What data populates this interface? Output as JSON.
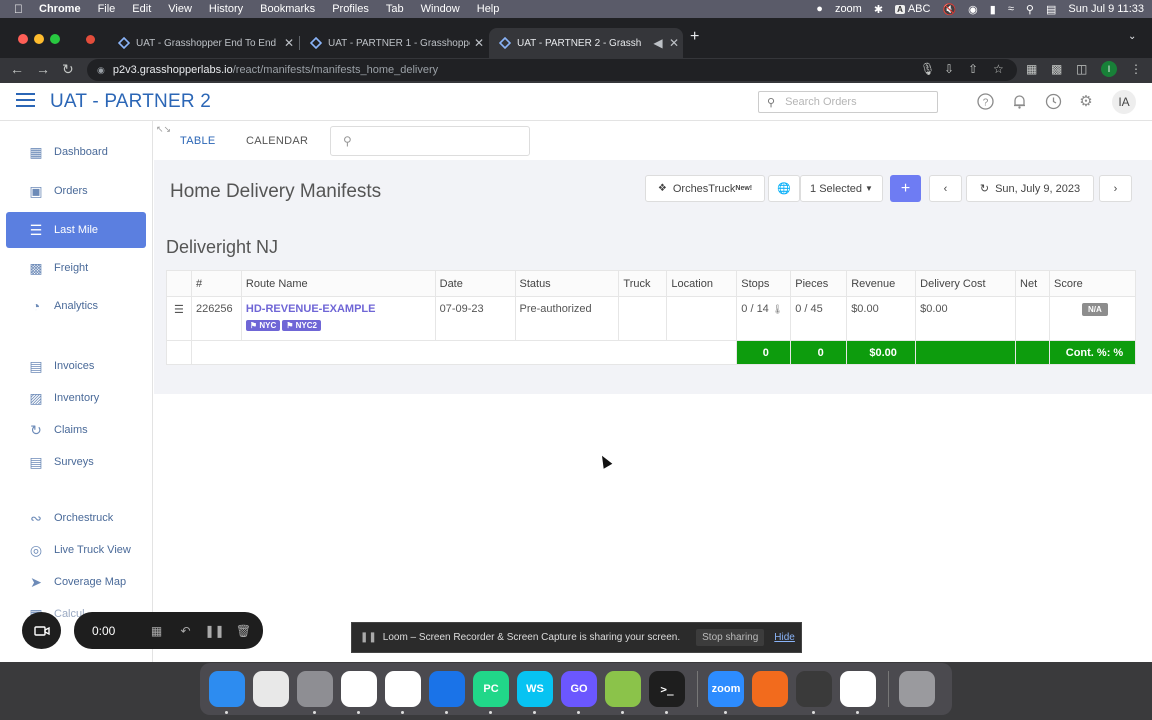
{
  "menubar": {
    "app": "Chrome",
    "items": [
      "File",
      "Edit",
      "View",
      "History",
      "Bookmarks",
      "Profiles",
      "Tab",
      "Window",
      "Help"
    ],
    "zoom": "zoom",
    "input_source": "ABC",
    "datetime": "Sun Jul 9  11:33"
  },
  "browser": {
    "tabs": [
      {
        "title": "UAT - Grasshopper End To End"
      },
      {
        "title": "UAT - PARTNER 1 - Grasshopper"
      },
      {
        "title": "UAT - PARTNER 2 - Grassh"
      }
    ],
    "new_tab": "+",
    "url_host": "p2v3.grasshopperlabs.io",
    "url_path": "/react/manifests/manifests_home_delivery",
    "profile_initial": "I"
  },
  "app": {
    "brand": "UAT - PARTNER 2",
    "search_placeholder": "Search Orders",
    "avatar": "IA"
  },
  "sidebar": {
    "items": [
      {
        "label": "Dashboard",
        "icon": "dashboard-icon"
      },
      {
        "label": "Orders",
        "icon": "box-icon"
      },
      {
        "label": "Last Mile",
        "icon": "last-mile-icon"
      },
      {
        "label": "Freight",
        "icon": "truck-icon"
      },
      {
        "label": "Analytics",
        "icon": "analytics-icon"
      },
      {
        "label": "Invoices",
        "icon": "invoice-icon"
      },
      {
        "label": "Inventory",
        "icon": "inventory-icon"
      },
      {
        "label": "Claims",
        "icon": "claims-icon"
      },
      {
        "label": "Surveys",
        "icon": "survey-icon"
      },
      {
        "label": "Orchestruck",
        "icon": "orchestruck-icon"
      },
      {
        "label": "Live Truck View",
        "icon": "target-icon"
      },
      {
        "label": "Coverage Map",
        "icon": "navigation-icon"
      },
      {
        "label": "Calcul",
        "icon": "calculator-icon"
      }
    ],
    "active": "Last Mile"
  },
  "main": {
    "tabs": [
      "TABLE",
      "CALENDAR"
    ],
    "active_tab": "TABLE",
    "page_title": "Home Delivery Manifests",
    "orchestruck_label": "OrchesTruck",
    "orchestruck_badge": "New!",
    "selected_label": "1 Selected",
    "add_label": "+",
    "date_label": "Sun, July 9, 2023",
    "group_title": "Deliveright NJ",
    "table": {
      "columns": [
        "",
        "#",
        "Route Name",
        "Date",
        "Status",
        "Truck",
        "Location",
        "Stops",
        "Pieces",
        "Revenue",
        "Delivery Cost",
        "Net",
        "Score"
      ],
      "row": {
        "id": "226256",
        "route_name": "HD-REVENUE-EXAMPLE",
        "tags": [
          "NYC",
          "NYC2"
        ],
        "date": "07-09-23",
        "status": "Pre-authorized",
        "truck": "",
        "location": "",
        "stops": "0 / 14",
        "pieces": "0 / 45",
        "revenue": "$0.00",
        "delivery_cost": "$0.00",
        "net": "",
        "score": "N/A"
      },
      "totals": {
        "stops": "0",
        "pieces": "0",
        "revenue": "$0.00",
        "score": "Cont. %: %"
      }
    }
  },
  "loom": {
    "timer": "0:00",
    "message": "Loom – Screen Recorder & Screen Capture is sharing your screen.",
    "stop_label": "Stop sharing",
    "hide_label": "Hide"
  },
  "dock": {
    "apps": [
      {
        "name": "Finder",
        "icon": "finder-icon",
        "color": "#2d8cf0",
        "running": true
      },
      {
        "name": "Launchpad",
        "icon": "launchpad-icon",
        "color": "#e8e8e8",
        "running": false
      },
      {
        "name": "System Settings",
        "icon": "settings-icon",
        "color": "#8e8e93",
        "running": true
      },
      {
        "name": "Chrome",
        "icon": "chrome-icon",
        "color": "#ffffff",
        "running": true
      },
      {
        "name": "Slack",
        "icon": "slack-icon",
        "color": "#ffffff",
        "running": true
      },
      {
        "name": "Maps",
        "icon": "maps-icon",
        "color": "#1a73e8",
        "running": true
      },
      {
        "name": "PyCharm",
        "icon": "pycharm-icon",
        "color": "#21d789",
        "label": "PC",
        "running": true
      },
      {
        "name": "WebStorm",
        "icon": "webstorm-icon",
        "color": "#07c3f2",
        "label": "WS",
        "running": true
      },
      {
        "name": "GoLand",
        "icon": "goland-icon",
        "color": "#6b57ff",
        "label": "GO",
        "running": true
      },
      {
        "name": "Sourcetree",
        "icon": "sourcetree-icon",
        "color": "#8bc34a",
        "running": true
      },
      {
        "name": "Terminal",
        "icon": "terminal-icon",
        "color": "#1e1e1e",
        "running": true
      },
      {
        "name": "Zoom",
        "icon": "zoom-icon",
        "color": "#2d8cff",
        "label": "zoom",
        "running": true
      },
      {
        "name": "Pencil",
        "icon": "pencil-icon",
        "color": "#f26b1d",
        "running": false
      },
      {
        "name": "Sublime Text",
        "icon": "sublime-icon",
        "color": "#3a3a3a",
        "running": true
      },
      {
        "name": "Chrome Canary",
        "icon": "chrome-icon",
        "color": "#ffffff",
        "running": true
      }
    ],
    "trash": {
      "name": "Trash",
      "icon": "trash-icon",
      "color": "#9a9a9e"
    }
  }
}
